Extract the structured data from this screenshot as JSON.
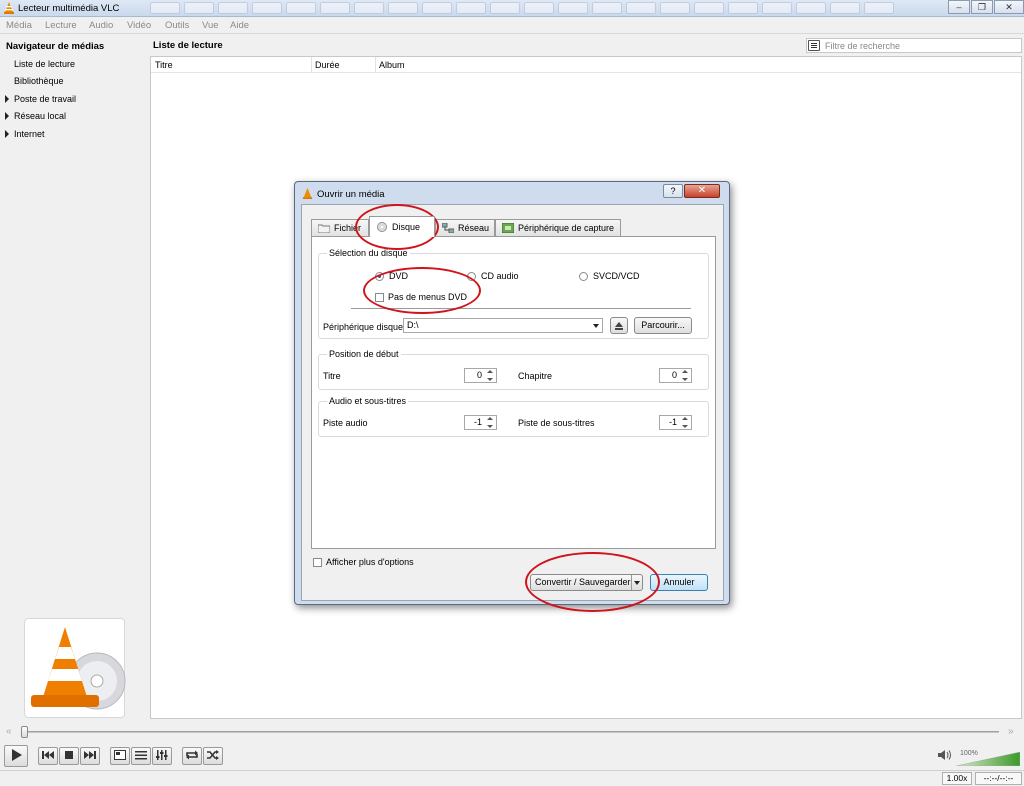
{
  "window": {
    "title": "Lecteur multimédia VLC",
    "min_icon": "minimize-icon",
    "max_icon": "maximize-icon",
    "close_icon": "close-icon"
  },
  "menu": [
    "Média",
    "Lecture",
    "Audio",
    "Vidéo",
    "Outils",
    "Vue",
    "Aide"
  ],
  "sidebar": {
    "heading": "Navigateur de médias",
    "items": [
      {
        "label": "Liste de lecture",
        "expandable": false
      },
      {
        "label": "Bibliothèque",
        "expandable": false
      },
      {
        "label": "Poste de travail",
        "expandable": true
      },
      {
        "label": "Réseau local",
        "expandable": true
      },
      {
        "label": "Internet",
        "expandable": true
      }
    ]
  },
  "playlist": {
    "title": "Liste de lecture",
    "search_placeholder": "Filtre de recherche",
    "columns": [
      "Titre",
      "Durée",
      "Album"
    ]
  },
  "dialog": {
    "title": "Ouvrir un média",
    "help": "?",
    "close": "✕",
    "tabs": [
      {
        "label": "Fichier",
        "icon": "folder-icon",
        "active": false
      },
      {
        "label": "Disque",
        "icon": "disc-icon",
        "active": true
      },
      {
        "label": "Réseau",
        "icon": "network-icon",
        "active": false
      },
      {
        "label": "Périphérique de capture",
        "icon": "capture-device-icon",
        "active": false
      }
    ],
    "disc_selection": {
      "label": "Sélection du disque",
      "options": [
        {
          "label": "DVD",
          "selected": true
        },
        {
          "label": "CD audio",
          "selected": false
        },
        {
          "label": "SVCD/VCD",
          "selected": false
        }
      ],
      "no_menus_label": "Pas de menus DVD",
      "no_menus_checked": false,
      "device_label": "Périphérique disque",
      "device_value": "D:\\",
      "browse_label": "Parcourir..."
    },
    "start_position": {
      "label": "Position de début",
      "title_label": "Titre",
      "title_value": "0",
      "chapter_label": "Chapitre",
      "chapter_value": "0"
    },
    "audio_subs": {
      "label": "Audio et sous-titres",
      "audio_label": "Piste audio",
      "audio_value": "-1",
      "subs_label": "Piste de sous-titres",
      "subs_value": "-1"
    },
    "more_options_label": "Afficher plus d'options",
    "convert_label": "Convertir / Sauvegarder",
    "cancel_label": "Annuler"
  },
  "controls": {
    "volume_pct": "100%",
    "speed": "1.00x",
    "time": "--:--/--:--"
  },
  "colors": {
    "annotation": "#d0141c",
    "accent": "#3c7fb1"
  }
}
